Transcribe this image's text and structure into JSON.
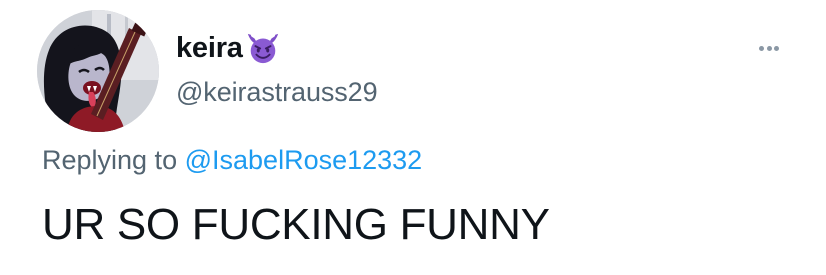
{
  "tweet": {
    "author": {
      "display_name": "keira",
      "handle": "@keirastrauss29",
      "badge_icon": "smiling-devil-emoji-icon",
      "avatar_icon": "cartoon-vampire-avatar"
    },
    "replying_prefix": "Replying to",
    "replying_to": "@IsabelRose12332",
    "text": "UR SO FUCKING FUNNY",
    "more_icon": "more-options-icon"
  },
  "colors": {
    "text_primary": "#0f1419",
    "text_secondary": "#536471",
    "link": "#1d9bf0",
    "emoji_purple": "#7f4fc9"
  }
}
